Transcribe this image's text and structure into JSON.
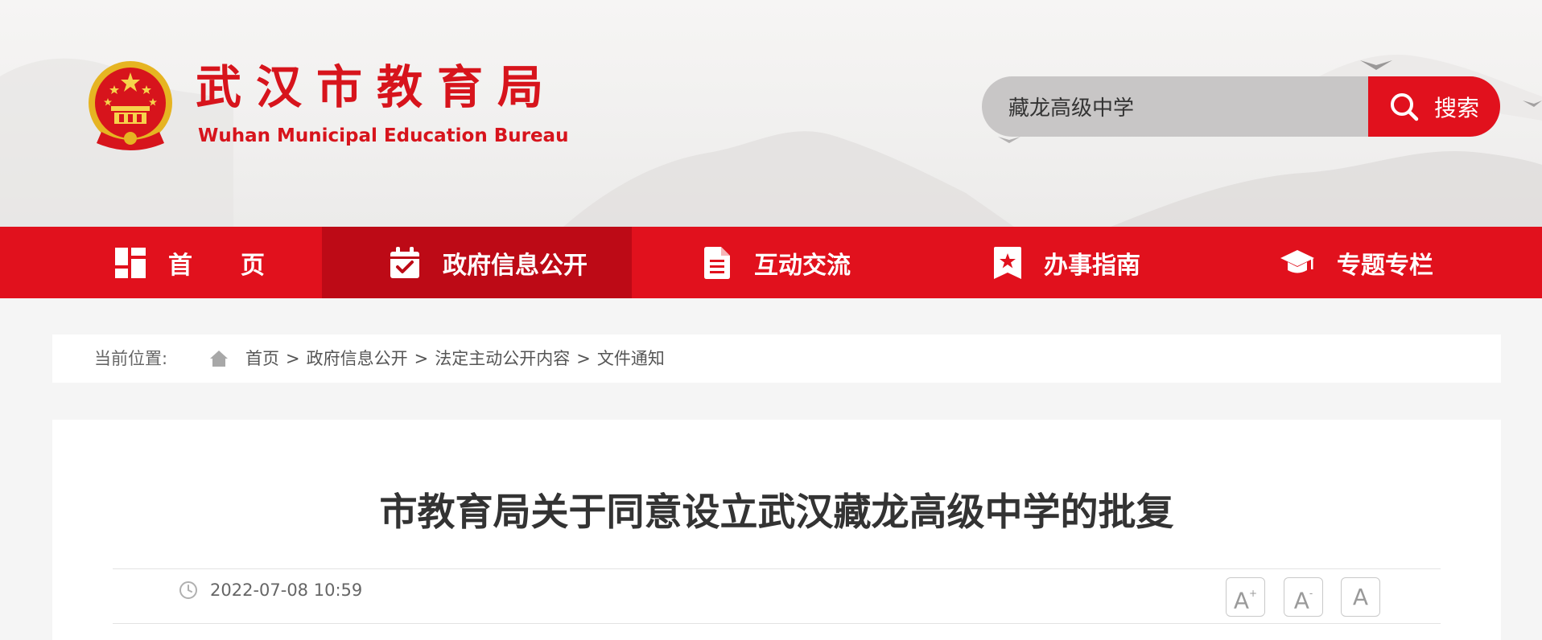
{
  "header": {
    "site_name_cn": "武汉市教育局",
    "site_name_en": "Wuhan Municipal Education Bureau",
    "emblem_icon": "national-emblem-icon"
  },
  "search": {
    "value": "藏龙高级中学",
    "button_label": "搜索",
    "icon": "search-icon"
  },
  "nav": {
    "items": [
      {
        "label": "首　　页",
        "icon": "home-grid-icon",
        "active": false
      },
      {
        "label": "政府信息公开",
        "icon": "calendar-check-icon",
        "active": true
      },
      {
        "label": "互动交流",
        "icon": "document-icon",
        "active": false
      },
      {
        "label": "办事指南",
        "icon": "bookmark-star-icon",
        "active": false
      },
      {
        "label": "专题专栏",
        "icon": "graduation-cap-icon",
        "active": false
      }
    ]
  },
  "breadcrumb": {
    "prefix": "当前位置:",
    "items": [
      "首页",
      "政府信息公开",
      "法定主动公开内容",
      "文件通知"
    ],
    "separator": ">"
  },
  "article": {
    "title": "市教育局关于同意设立武汉藏龙高级中学的批复",
    "date": "2022-07-08 10:59",
    "font_controls": [
      {
        "label": "A",
        "sup": "+"
      },
      {
        "label": "A",
        "sup": "-"
      },
      {
        "label": "A",
        "sup": ""
      }
    ]
  },
  "colors": {
    "brand_red": "#e1111d",
    "nav_active": "#bd0a16",
    "title_red": "#d7141c"
  }
}
